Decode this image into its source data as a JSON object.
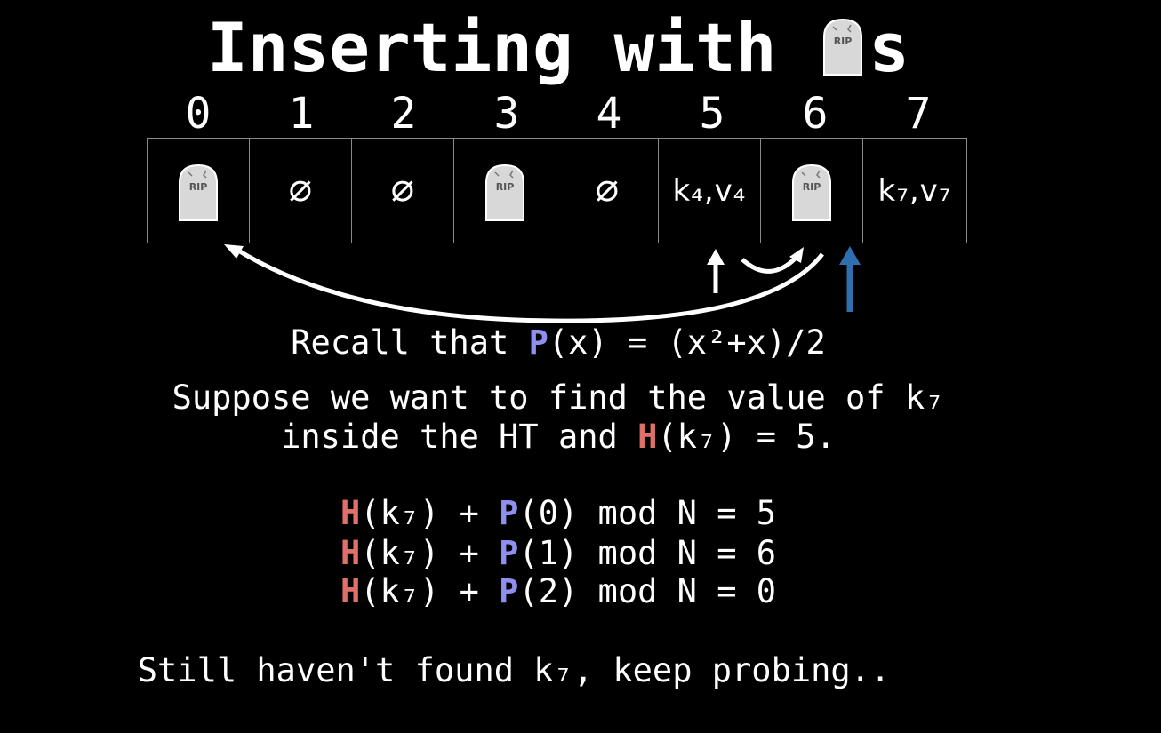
{
  "title": {
    "prefix": "Inserting with ",
    "tomb_icon": "tombstone-icon",
    "tomb_text": "RIP",
    "suffix": "s"
  },
  "table": {
    "indices": [
      "0",
      "1",
      "2",
      "3",
      "4",
      "5",
      "6",
      "7"
    ],
    "cells": [
      {
        "kind": "tombstone",
        "icon": "tombstone-icon",
        "text": "RIP"
      },
      {
        "kind": "null",
        "text": "∅"
      },
      {
        "kind": "null",
        "text": "∅"
      },
      {
        "kind": "tombstone",
        "icon": "tombstone-icon",
        "text": "RIP"
      },
      {
        "kind": "null",
        "text": "∅"
      },
      {
        "kind": "pair",
        "text": "k₄,v₄"
      },
      {
        "kind": "tombstone",
        "icon": "tombstone-icon",
        "text": "RIP"
      },
      {
        "kind": "pair",
        "text": "k₇,v₇"
      }
    ]
  },
  "colors": {
    "hash_fn": "#e0706a",
    "probe_fn": "#8f8ff0",
    "blue_pointer": "#2f6fb0",
    "white_pointer": "#ffffff"
  },
  "recall": {
    "before": "Recall that ",
    "p": "P",
    "after": "(x) = (x²+x)/2"
  },
  "suppose": {
    "line1": "Suppose we want to find the value of k₇",
    "line2_before": "inside the HT and ",
    "h": "H",
    "line2_after": "(k₇) = 5."
  },
  "probes": [
    {
      "h": "H",
      "mid": "(k₇) + ",
      "p": "P",
      "tail": "(0) mod N = 5"
    },
    {
      "h": "H",
      "mid": "(k₇) + ",
      "p": "P",
      "tail": "(1) mod N = 6"
    },
    {
      "h": "H",
      "mid": "(k₇) + ",
      "p": "P",
      "tail": "(2) mod N = 0"
    }
  ],
  "footer": "Still haven't found k₇, keep probing.."
}
